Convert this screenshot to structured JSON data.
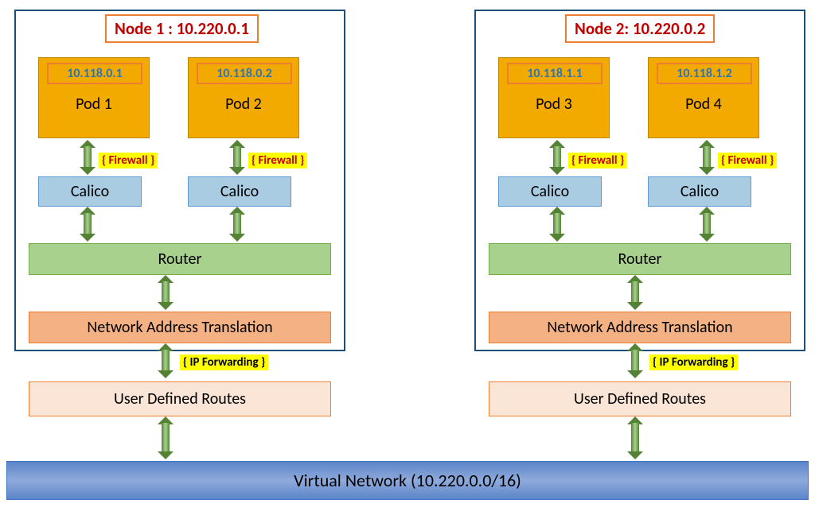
{
  "nodes": [
    {
      "title": "Node 1 : 10.220.0.1",
      "pods": [
        {
          "ip": "10.118.0.1",
          "label": "Pod 1"
        },
        {
          "ip": "10.118.0.2",
          "label": "Pod 2"
        }
      ],
      "firewall_label": "{ Firewall }",
      "calico_label": "Calico",
      "router_label": "Router",
      "nat_label": "Network Address Translation",
      "ipfwd_label": "{ IP Forwarding }",
      "udr_label": "User Defined Routes"
    },
    {
      "title": "Node 2: 10.220.0.2",
      "pods": [
        {
          "ip": "10.118.1.1",
          "label": "Pod 3"
        },
        {
          "ip": "10.118.1.2",
          "label": "Pod 4"
        }
      ],
      "firewall_label": "{ Firewall }",
      "calico_label": "Calico",
      "router_label": "Router",
      "nat_label": "Network Address Translation",
      "ipfwd_label": "{ IP Forwarding }",
      "udr_label": "User Defined Routes"
    }
  ],
  "vnet_label": "Virtual Network (10.220.0.0/16)"
}
